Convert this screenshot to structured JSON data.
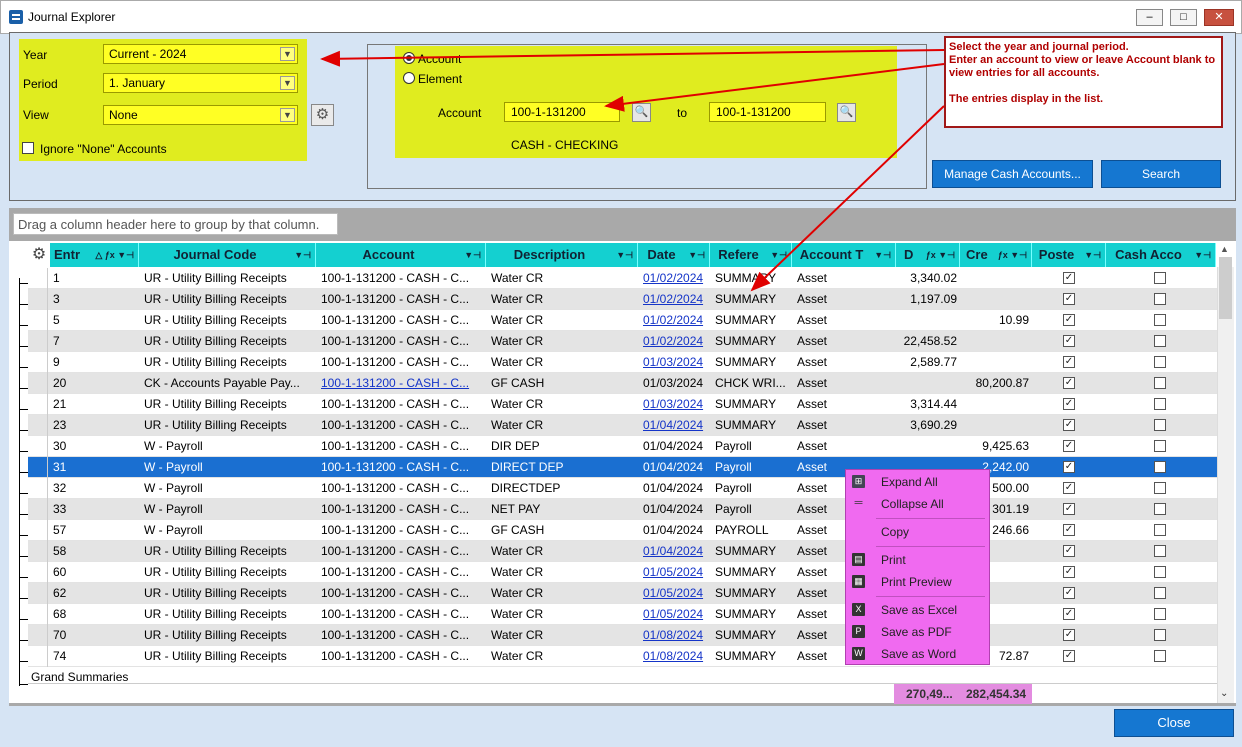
{
  "window": {
    "title": "Journal Explorer",
    "min_glyph": "–",
    "max_glyph": "□",
    "close_glyph": "✕"
  },
  "filters": {
    "year_label": "Year",
    "year_value": "Current - 2024",
    "period_label": "Period",
    "period_value": "1. January",
    "view_label": "View",
    "view_value": "None",
    "ignore_none_label": "Ignore \"None\" Accounts"
  },
  "account_panel": {
    "radio_account": "Account",
    "radio_element": "Element",
    "account_label": "Account",
    "from_value": "100-1-131200",
    "to_label": "to",
    "to_value": "100-1-131200",
    "account_name": "CASH - CHECKING"
  },
  "note": {
    "line1": "Select the year and journal period.",
    "line2": "Enter an account to view or leave  Account blank to view entries for all accounts.",
    "line3": "The entries display in the list."
  },
  "buttons": {
    "manage_cash": "Manage Cash Accounts...",
    "search": "Search",
    "close": "Close"
  },
  "grid": {
    "group_hint": "Drag a column header here to group by that column.",
    "columns": [
      "Entr",
      "Journal Code",
      "Account",
      "Description",
      "Date",
      "Refere",
      "Account T",
      "D",
      "Cre",
      "Poste",
      "Cash Acco"
    ],
    "rows": [
      {
        "entry": "1",
        "code": "UR - Utility Billing Receipts",
        "account": "100-1-131200 - CASH - C...",
        "desc": "Water CR",
        "date": "01/02/2024",
        "ref": "SUMMARY",
        "type": "Asset",
        "debit": "3,340.02",
        "credit": "",
        "posted": true,
        "cash": false
      },
      {
        "entry": "3",
        "code": "UR - Utility Billing Receipts",
        "account": "100-1-131200 - CASH - C...",
        "desc": "Water CR",
        "date": "01/02/2024",
        "ref": "SUMMARY",
        "type": "Asset",
        "debit": "1,197.09",
        "credit": "",
        "posted": true,
        "cash": false
      },
      {
        "entry": "5",
        "code": "UR - Utility Billing Receipts",
        "account": "100-1-131200 - CASH - C...",
        "desc": "Water CR",
        "date": "01/02/2024",
        "ref": "SUMMARY",
        "type": "Asset",
        "debit": "",
        "credit": "10.99",
        "posted": true,
        "cash": false
      },
      {
        "entry": "7",
        "code": "UR - Utility Billing Receipts",
        "account": "100-1-131200 - CASH - C...",
        "desc": "Water CR",
        "date": "01/02/2024",
        "ref": "SUMMARY",
        "type": "Asset",
        "debit": "22,458.52",
        "credit": "",
        "posted": true,
        "cash": false
      },
      {
        "entry": "9",
        "code": "UR - Utility Billing Receipts",
        "account": "100-1-131200 - CASH - C...",
        "desc": "Water CR",
        "date": "01/03/2024",
        "ref": "SUMMARY",
        "type": "Asset",
        "debit": "2,589.77",
        "credit": "",
        "posted": true,
        "cash": false
      },
      {
        "entry": "20",
        "code": "CK - Accounts Payable Pay...",
        "account": "100-1-131200 - CASH - C...",
        "desc": "GF CASH",
        "date": "01/03/2024",
        "ref": "CHCK WRI...",
        "type": "Asset",
        "debit": "",
        "credit": "80,200.87",
        "posted": true,
        "cash": false
      },
      {
        "entry": "21",
        "code": "UR - Utility Billing Receipts",
        "account": "100-1-131200 - CASH - C...",
        "desc": "Water CR",
        "date": "01/03/2024",
        "ref": "SUMMARY",
        "type": "Asset",
        "debit": "3,314.44",
        "credit": "",
        "posted": true,
        "cash": false
      },
      {
        "entry": "23",
        "code": "UR - Utility Billing Receipts",
        "account": "100-1-131200 - CASH - C...",
        "desc": "Water CR",
        "date": "01/04/2024",
        "ref": "SUMMARY",
        "type": "Asset",
        "debit": "3,690.29",
        "credit": "",
        "posted": true,
        "cash": false
      },
      {
        "entry": "30",
        "code": "W - Payroll",
        "account": "100-1-131200 - CASH - C...",
        "desc": "DIR DEP",
        "date": "01/04/2024",
        "ref": "Payroll",
        "type": "Asset",
        "debit": "",
        "credit": "9,425.63",
        "posted": true,
        "cash": false
      },
      {
        "entry": "31",
        "code": "W - Payroll",
        "account": "100-1-131200 - CASH - C...",
        "desc": "DIRECT DEP",
        "date": "01/04/2024",
        "ref": "Payroll",
        "type": "Asset",
        "debit": "",
        "credit": "2,242.00",
        "posted": true,
        "cash": false
      },
      {
        "entry": "32",
        "code": "W - Payroll",
        "account": "100-1-131200 - CASH - C...",
        "desc": "DIRECTDEP",
        "date": "01/04/2024",
        "ref": "Payroll",
        "type": "Asset",
        "debit": "",
        "credit": "500.00",
        "posted": true,
        "cash": false
      },
      {
        "entry": "33",
        "code": "W - Payroll",
        "account": "100-1-131200 - CASH - C...",
        "desc": "NET PAY",
        "date": "01/04/2024",
        "ref": "Payroll",
        "type": "Asset",
        "debit": "",
        "credit": "301.19",
        "posted": true,
        "cash": false
      },
      {
        "entry": "57",
        "code": "W - Payroll",
        "account": "100-1-131200 - CASH - C...",
        "desc": "GF CASH",
        "date": "01/04/2024",
        "ref": "PAYROLL",
        "type": "Asset",
        "debit": "",
        "credit": "246.66",
        "posted": true,
        "cash": false
      },
      {
        "entry": "58",
        "code": "UR - Utility Billing Receipts",
        "account": "100-1-131200 - CASH - C...",
        "desc": "Water CR",
        "date": "01/04/2024",
        "ref": "SUMMARY",
        "type": "Asset",
        "debit": "",
        "credit": "",
        "posted": true,
        "cash": false
      },
      {
        "entry": "60",
        "code": "UR - Utility Billing Receipts",
        "account": "100-1-131200 - CASH - C...",
        "desc": "Water CR",
        "date": "01/05/2024",
        "ref": "SUMMARY",
        "type": "Asset",
        "debit": "",
        "credit": "",
        "posted": true,
        "cash": false
      },
      {
        "entry": "62",
        "code": "UR - Utility Billing Receipts",
        "account": "100-1-131200 - CASH - C...",
        "desc": "Water CR",
        "date": "01/05/2024",
        "ref": "SUMMARY",
        "type": "Asset",
        "debit": "",
        "credit": "",
        "posted": true,
        "cash": false
      },
      {
        "entry": "68",
        "code": "UR - Utility Billing Receipts",
        "account": "100-1-131200 - CASH - C...",
        "desc": "Water CR",
        "date": "01/05/2024",
        "ref": "SUMMARY",
        "type": "Asset",
        "debit": "",
        "credit": "",
        "posted": true,
        "cash": false
      },
      {
        "entry": "70",
        "code": "UR - Utility Billing Receipts",
        "account": "100-1-131200 - CASH - C...",
        "desc": "Water CR",
        "date": "01/08/2024",
        "ref": "SUMMARY",
        "type": "Asset",
        "debit": "",
        "credit": "",
        "posted": true,
        "cash": false
      },
      {
        "entry": "74",
        "code": "UR - Utility Billing Receipts",
        "account": "100-1-131200 - CASH - C...",
        "desc": "Water CR",
        "date": "01/08/2024",
        "ref": "SUMMARY",
        "type": "Asset",
        "debit": "",
        "credit": "72.87",
        "posted": true,
        "cash": false
      }
    ],
    "grand_summaries_label": "Grand Summaries",
    "sum_debit": "270,49...",
    "sum_credit": "282,454.34"
  },
  "context_menu": {
    "expand_all": "Expand All",
    "collapse_all": "Collapse All",
    "copy": "Copy",
    "print": "Print",
    "print_preview": "Print Preview",
    "save_excel": "Save as Excel",
    "save_pdf": "Save as PDF",
    "save_word": "Save as Word"
  },
  "colors": {
    "highlight_yellow": "#e0ec1f",
    "header_cyan": "#14d0d0",
    "selection_blue": "#1a6fd1",
    "menu_magenta": "#f06af0",
    "annotation_red": "#e00000"
  }
}
